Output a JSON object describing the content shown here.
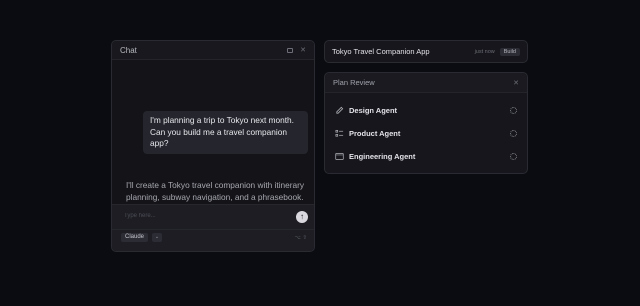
{
  "chat": {
    "title": "Chat",
    "user_message": "I'm planning a trip to Tokyo next month. Can you build me a travel companion app?",
    "assistant_message": "I'll create a Tokyo travel companion with itinerary planning, subway navigation, and a phrasebook. Let me draft a plan.",
    "composer": {
      "placeholder": "Type here...",
      "model": "Claude",
      "shortcut": "⌥ ⇧"
    }
  },
  "app_bar": {
    "name": "Tokyo Travel Companion App",
    "time": "just now",
    "badge": "Build"
  },
  "plan_review": {
    "title": "Plan Review",
    "agents": [
      {
        "label": "Design Agent",
        "icon": "pencil-icon"
      },
      {
        "label": "Product Agent",
        "icon": "list-icon"
      },
      {
        "label": "Engineering Agent",
        "icon": "terminal-icon"
      }
    ]
  },
  "colors": {
    "background": "#0b0b12",
    "panel": "#16161c",
    "user_bubble": "#25252d",
    "send_button": "#d8d8de"
  }
}
